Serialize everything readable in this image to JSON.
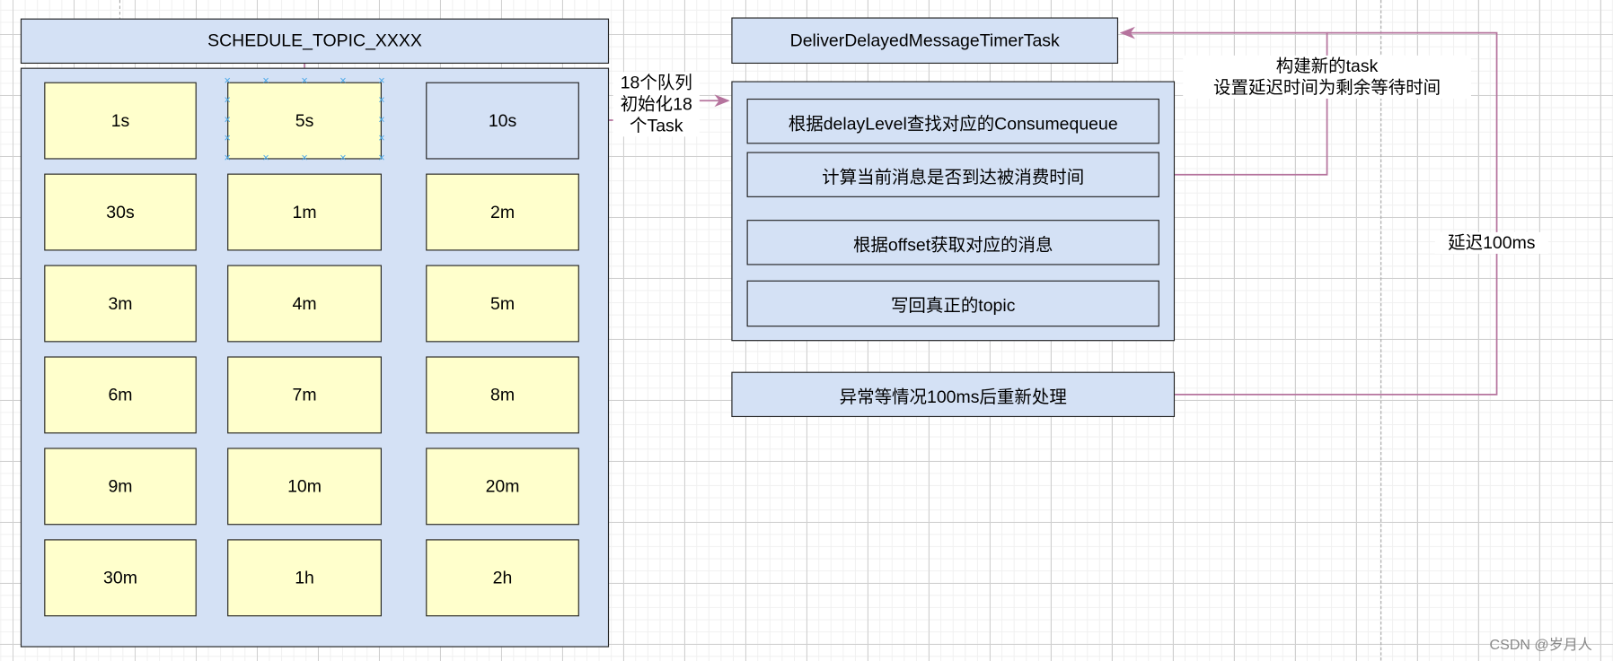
{
  "topic_header": "SCHEDULE_TOPIC_XXXX",
  "delay_levels": [
    "1s",
    "5s",
    "10s",
    "30s",
    "1m",
    "2m",
    "3m",
    "4m",
    "5m",
    "6m",
    "7m",
    "8m",
    "9m",
    "10m",
    "20m",
    "30m",
    "1h",
    "2h"
  ],
  "highlighted_level": "10s",
  "selected_level": "5s",
  "init_label": "18个队列\n初始化18\n个Task",
  "timer_task": "DeliverDelayedMessageTimerTask",
  "steps": [
    "根据delayLevel查找对应的Consumequeue",
    "计算当前消息是否到达被消费时间",
    "根据offset获取对应的消息",
    "写回真正的topic"
  ],
  "retry_box": "异常等情况100ms后重新处理",
  "rebuild_label": "构建新的task\n设置延迟时间为剩余等待时间",
  "delay_label": "延迟100ms",
  "watermark": "CSDN @岁月人",
  "colors": {
    "box_blue": "#d4e1f5",
    "cell_yellow": "#ffffcc",
    "arrow": "#b5739d",
    "selection": "#4aa8e8"
  }
}
